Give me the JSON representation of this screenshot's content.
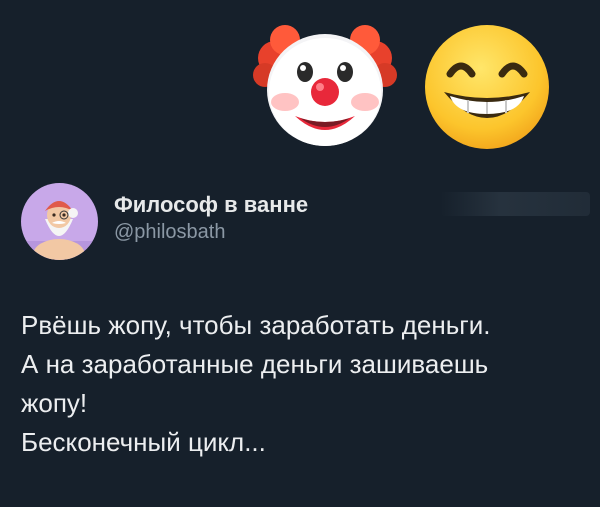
{
  "header": {
    "emojis": [
      {
        "name": "clown-face-emoji",
        "char": "🤡"
      },
      {
        "name": "beaming-face-emoji",
        "char": "😁"
      }
    ]
  },
  "author": {
    "display_name": "Философ в ванне",
    "handle": "@philosbath",
    "avatar_icon": "bearded-philosopher-avatar"
  },
  "tweet": {
    "lines": [
      "Рвёшь жопу, чтобы заработать деньги.",
      "А на заработанные деньги зашиваешь",
      "жопу!",
      "Бесконечный цикл..."
    ]
  },
  "colors": {
    "background": "#16202b",
    "text_primary": "#e7e9ea",
    "text_secondary": "#8b98a5",
    "avatar_bg": "#c8a8e9"
  }
}
